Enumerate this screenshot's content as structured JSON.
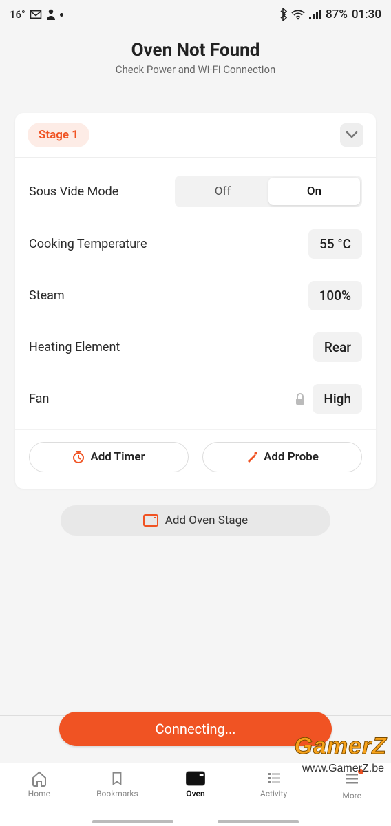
{
  "status": {
    "temp": "16°",
    "battery": "87%",
    "time": "01:30"
  },
  "header": {
    "title": "Oven Not Found",
    "subtitle": "Check Power and Wi-Fi Connection"
  },
  "stage": {
    "label": "Stage 1",
    "sous_vide": {
      "label": "Sous Vide Mode",
      "off": "Off",
      "on": "On",
      "value": "On"
    },
    "cooking_temp": {
      "label": "Cooking Temperature",
      "value": "55 °C"
    },
    "steam": {
      "label": "Steam",
      "value": "100%"
    },
    "heating": {
      "label": "Heating Element",
      "value": "Rear"
    },
    "fan": {
      "label": "Fan",
      "value": "High"
    }
  },
  "card_buttons": {
    "timer": "Add Timer",
    "probe": "Add Probe"
  },
  "add_stage": "Add Oven Stage",
  "connecting": "Connecting...",
  "nav": {
    "home": "Home",
    "bookmarks": "Bookmarks",
    "oven": "Oven",
    "activity": "Activity",
    "more": "More"
  },
  "watermark": {
    "brand": "GamerZ",
    "url": "www.GamerZ.be"
  }
}
